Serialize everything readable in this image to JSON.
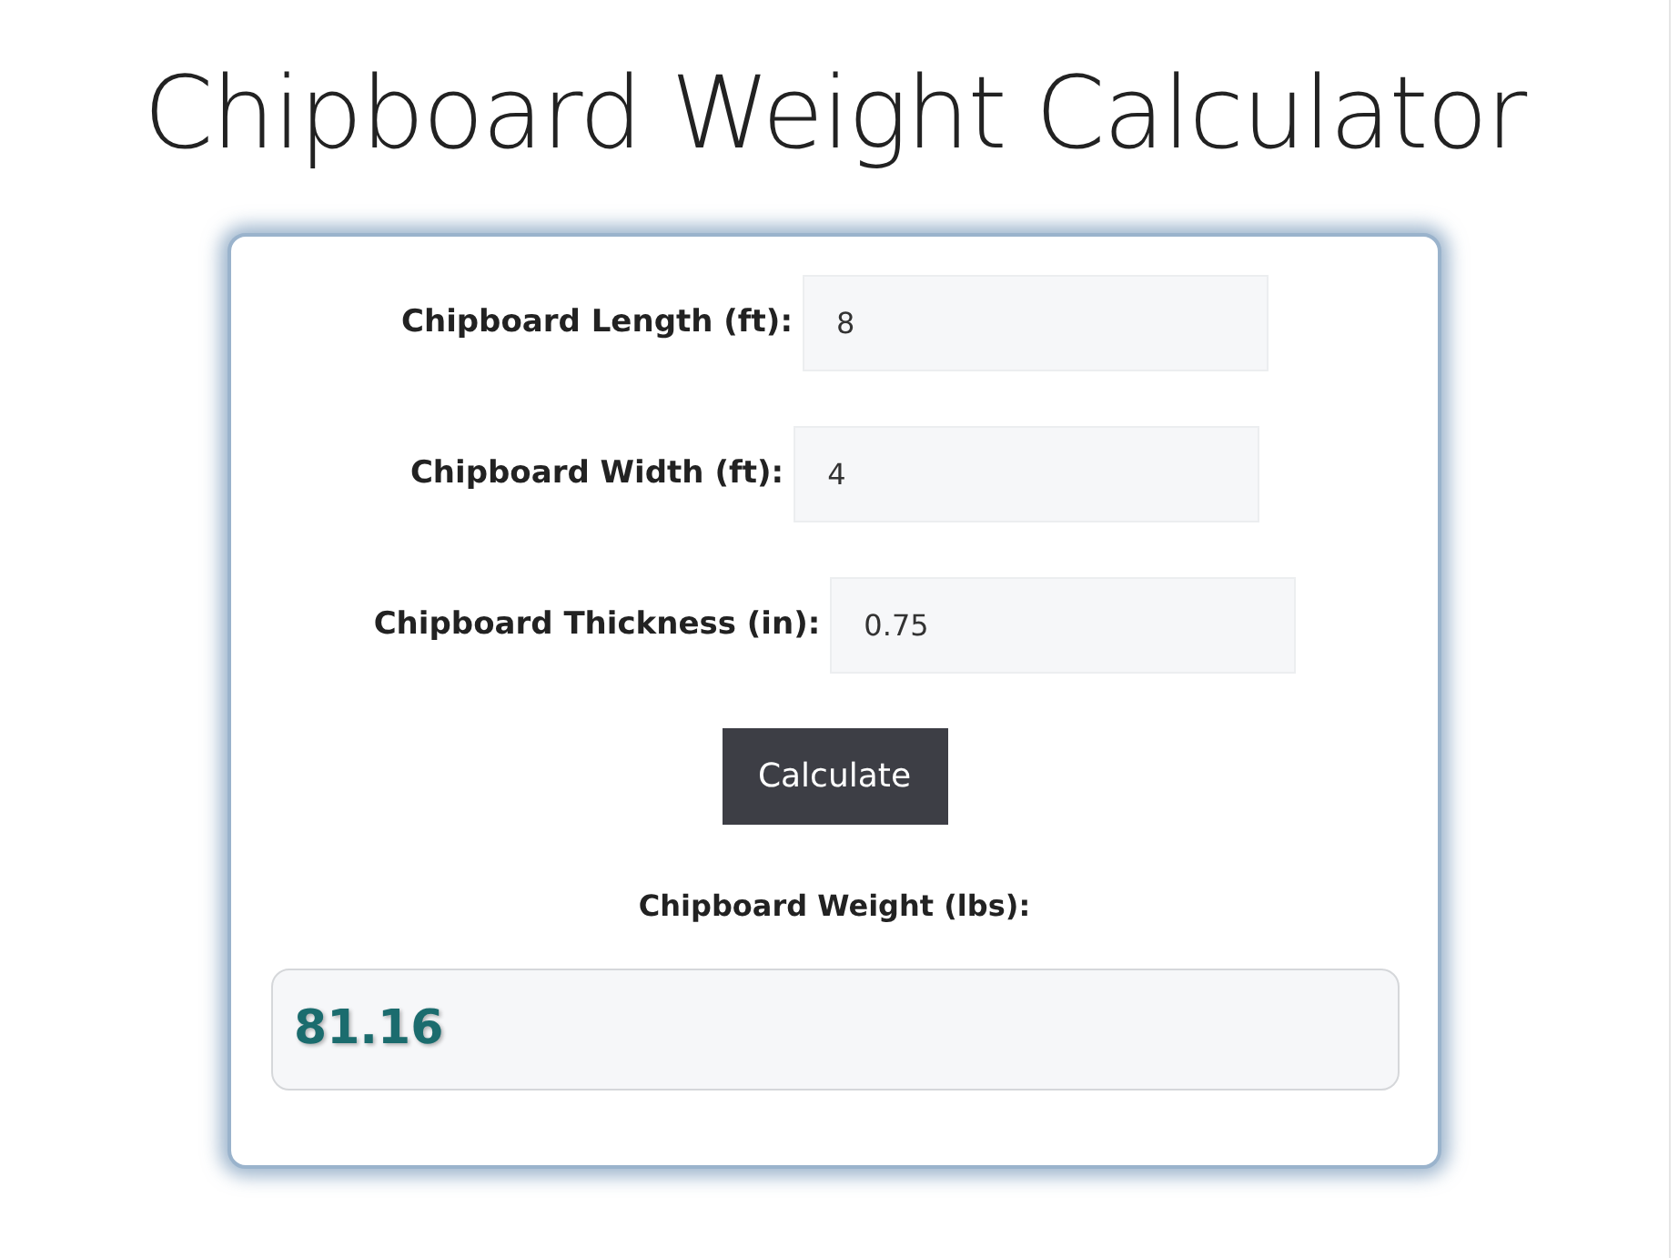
{
  "title": "Chipboard Weight Calculator",
  "fields": [
    {
      "label": "Chipboard Length (ft):",
      "value": "8"
    },
    {
      "label": "Chipboard Width (ft):",
      "value": "4"
    },
    {
      "label": "Chipboard Thickness (in):",
      "value": "0.75"
    }
  ],
  "button": "Calculate",
  "result": {
    "label": "Chipboard Weight (lbs):",
    "value": "81.16"
  }
}
